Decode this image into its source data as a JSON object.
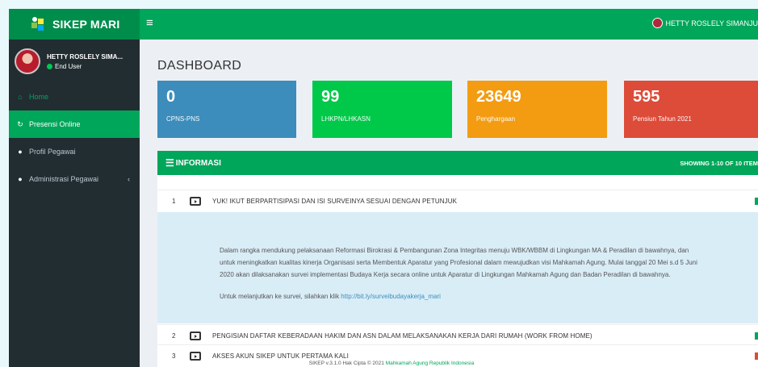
{
  "brand": {
    "name": "SIKEP MARI",
    "menu_icon": "hamburger-icon"
  },
  "topbar": {
    "user_name": "HETTY ROSLELY SIMANJU"
  },
  "sidebar": {
    "user_name": "HETTY ROSLELY SIMA...",
    "user_role": "End User",
    "items": [
      {
        "label": "Home",
        "icon": "home-icon"
      },
      {
        "label": "Presensi Online",
        "icon": "refresh-icon"
      },
      {
        "label": "Profil Pegawai",
        "icon": "user-icon"
      },
      {
        "label": "Administrasi Pegawai",
        "icon": "users-icon"
      }
    ]
  },
  "page": {
    "title": "DASHBOARD"
  },
  "stats": [
    {
      "value": "0",
      "label": "CPNS-PNS",
      "color": "#3c8dbc"
    },
    {
      "value": "99",
      "label": "LHKPN/LHKASN",
      "color": "#00c94a"
    },
    {
      "value": "23649",
      "label": "Penghargaan",
      "color": "#f39c12"
    },
    {
      "value": "595",
      "label": "Pensiun Tahun 2021",
      "color": "#dd4b39"
    }
  ],
  "info": {
    "title": "INFORMASI",
    "showing": "SHOWING 1-10 OF 10 ITEM",
    "rows": [
      {
        "no": "1",
        "title": "YUK! IKUT BERPARTISIPASI DAN ISI SURVEINYA SESUAI DENGAN PETUNJUK"
      },
      {
        "no": "2",
        "title": "PENGISIAN DAFTAR KEBERADAAN HAKIM DAN ASN DALAM MELAKSANAKAN KERJA DARI RUMAH (WORK FROM HOME)"
      },
      {
        "no": "3",
        "title": "AKSES AKUN SIKEP UNTUK PERTAMA KALI"
      }
    ],
    "detail_paragraph": "Dalam rangka mendukung pelaksanaan Reformasi Birokrasi & Pembangunan Zona Integritas menuju WBK/WBBM di Lingkungan MA & Peradilan di bawahnya, dan untuk meningkatkan kualitas kinerja Organisasi serta Membentuk Aparatur yang Profesional dalam mewujudkan visi Mahkamah Agung. Mulai tanggal 20 Mei s.d 5 Juni 2020 akan dilaksanakan survei implementasi Budaya Kerja secara online untuk Aparatur di Lingkungan Mahkamah Agung dan Badan Peradilan di bawahnya.",
    "detail_link_prefix": "Untuk melanjutkan ke survei, silahkan klik ",
    "detail_link": "http://bit.ly/surveibudayakerja_mari"
  },
  "footer": {
    "text": "SIKEP v.3.1.0 Hak Cipta © 2021 ",
    "link": "Mahkamah Agung Republik Indonesia"
  }
}
